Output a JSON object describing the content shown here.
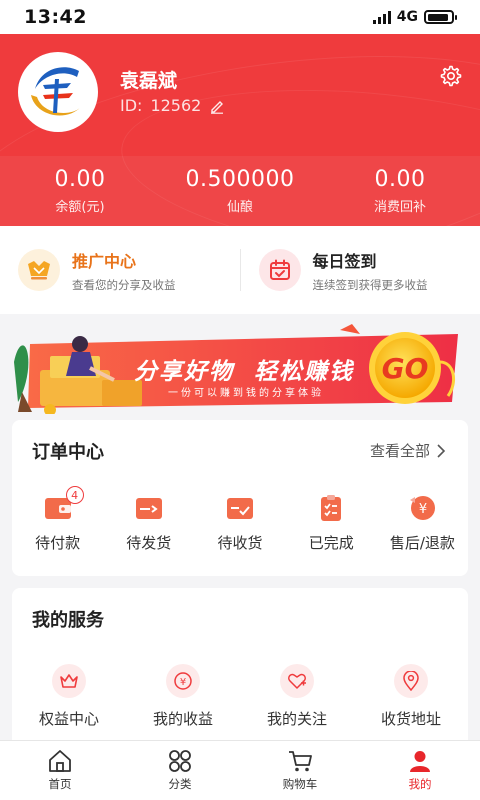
{
  "status_bar": {
    "time": "13:42",
    "network": "4G"
  },
  "profile": {
    "name": "袁磊斌",
    "id_label": "ID:",
    "id_value": "12562"
  },
  "stats": [
    {
      "value": "0.00",
      "label": "余额(元)"
    },
    {
      "value": "0.500000",
      "label": "仙酿"
    },
    {
      "value": "0.00",
      "label": "消费回补"
    }
  ],
  "promos": [
    {
      "title": "推广中心",
      "subtitle": "查看您的分享及收益",
      "title_color": "#e8731a"
    },
    {
      "title": "每日签到",
      "subtitle": "连续签到获得更多收益",
      "title_color": "#222222"
    }
  ],
  "banner": {
    "headline": "分享好物  轻松赚钱",
    "subline": "一份可以赚到钱的分享体验",
    "cta": "GO"
  },
  "orders": {
    "title": "订单中心",
    "view_all": "查看全部",
    "items": [
      {
        "label": "待付款",
        "badge": "4"
      },
      {
        "label": "待发货"
      },
      {
        "label": "待收货"
      },
      {
        "label": "已完成"
      },
      {
        "label": "售后/退款"
      }
    ]
  },
  "services": {
    "title": "我的服务",
    "items": [
      {
        "label": "权益中心",
        "icon": "crown-icon"
      },
      {
        "label": "我的收益",
        "icon": "yuan-icon"
      },
      {
        "label": "我的关注",
        "icon": "heart-plus-icon"
      },
      {
        "label": "收货地址",
        "icon": "location-icon"
      }
    ]
  },
  "tabbar": [
    {
      "label": "首页",
      "icon": "home-icon"
    },
    {
      "label": "分类",
      "icon": "category-icon"
    },
    {
      "label": "购物车",
      "icon": "cart-icon"
    },
    {
      "label": "我的",
      "icon": "user-icon",
      "active": true
    }
  ],
  "colors": {
    "brand_red": "#ef3b3d",
    "accent_orange": "#f0683a",
    "active_tab": "#e8262b"
  }
}
